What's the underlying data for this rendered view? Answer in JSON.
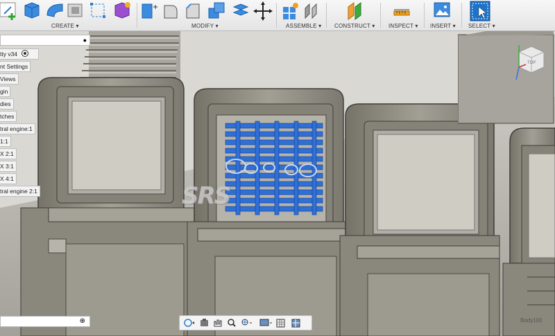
{
  "toolbar": {
    "create": "CREATE ▾",
    "modify": "MODIFY ▾",
    "assemble": "ASSEMBLE ▾",
    "construct": "CONSTRUCT ▾",
    "inspect": "INSPECT ▾",
    "insert": "INSERT ▾",
    "select": "SELECT ▾"
  },
  "browser": {
    "title": "tty v34",
    "items": [
      "nt Settings",
      "Views",
      "gin",
      "dies",
      "tches",
      "tral engine:1",
      " 1:1",
      "X 2:1",
      "X 3:1",
      "X 4:1",
      "tral engine 2:1"
    ]
  },
  "viewcube": {
    "face": "TOP"
  },
  "watermark": "SRS",
  "body_label": "Body100",
  "icons": {
    "create": [
      "sketch-icon",
      "box-icon",
      "pipe-icon",
      "shell-icon",
      "rectangle-select-icon",
      "form-icon"
    ],
    "modify": [
      "press-pull-icon",
      "fillet-icon",
      "chamfer-icon",
      "combine-icon",
      "offset-icon",
      "move-icon"
    ],
    "assemble": [
      "new-component-icon",
      "joint-icon"
    ],
    "construct": [
      "offset-plane-icon"
    ],
    "inspect": [
      "measure-icon"
    ],
    "insert": [
      "insert-image-icon"
    ],
    "select": [
      "select-icon"
    ]
  },
  "colors": {
    "selection": "#2f6fd6",
    "model": "#8d8a7f",
    "toolbar_bg": "#ececec",
    "accent": "#1a8fd8"
  }
}
